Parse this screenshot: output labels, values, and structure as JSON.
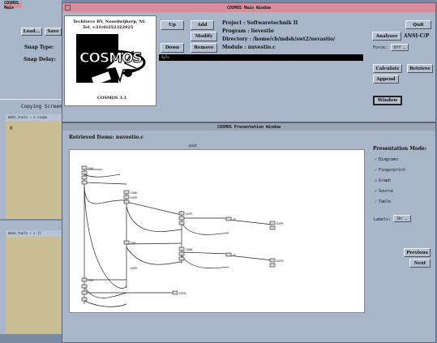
{
  "background_windows": {
    "top_left_title": "COSMOS Main",
    "load_label": "Load...",
    "save_label": "Save",
    "snap_type_label": "Snap Type:",
    "snap_delay_label": "Snap Delay:",
    "copying_title": "Copying Screen...",
    "xterm1_prompt": "mdsh_tools ~ > scope",
    "xterm1_cursor": "0",
    "xterm2_prompt": "mdsh_tools ~ > []"
  },
  "main_window": {
    "title": "COSMOS Main Window",
    "logo": {
      "company": "Techforce BV, Noordwijkerp, NL",
      "tel": "Tel. +31(0)252322925",
      "wordmark": "COSMOS",
      "version": "COSMOS 3.3"
    },
    "buttons": {
      "up": "Up",
      "add": "Add",
      "modify": "Modify",
      "down": "Down",
      "remove": "Remove",
      "quit": "Quit",
      "analyser": "Analyser",
      "calculate": "Calculate",
      "retrieve": "Retrieve",
      "append": "Append",
      "window": "Window"
    },
    "info": {
      "project": "Project   : Softwaretechnik II",
      "program": "Program   : lievestio",
      "directory": "Directory : /home/cb/mdsh/swt2/uevastio/",
      "module": "Module    : nuvestio.c"
    },
    "selected_entry": "Sylv",
    "language": "ANSI-C/P",
    "force_label": "Force:",
    "force_value": "Off"
  },
  "presentation_window": {
    "title": "COSMOS Presentation Window",
    "retrieved": "Retrieved Items: nuvestio.c",
    "canvas_caption": "plot",
    "mode_title": "Presentation Mode:",
    "modes": [
      {
        "label": "Diagrams",
        "checked": true
      },
      {
        "label": "Fingerprint",
        "checked": true
      },
      {
        "label": "Graph",
        "checked": false
      },
      {
        "label": "Source",
        "checked": true
      },
      {
        "label": "Table",
        "checked": true
      }
    ],
    "labels_label": "Labels:",
    "labels_value": "On",
    "previous": "Previous",
    "next": "Next",
    "graph_labels": {
      "for": "FOR",
      "expr": "EXPR",
      "if": "IF",
      "cond": "COND"
    }
  },
  "colors": {
    "main_titlebar": "#d88e9c",
    "presentation_titlebar": "#9aa4b3",
    "panel": "#a9b6c9",
    "desktop": "#7a8aa0",
    "xterm_bg": "#c9bd93",
    "canvas": "#ffffff"
  }
}
